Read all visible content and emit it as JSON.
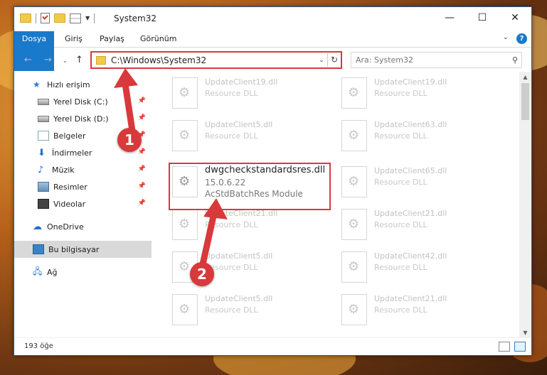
{
  "window": {
    "title": "System32",
    "controls": {
      "minimize": "—",
      "maximize": "☐",
      "close": "✕"
    }
  },
  "ribbon": {
    "tabs": [
      "Dosya",
      "Giriş",
      "Paylaş",
      "Görünüm"
    ],
    "help": "?"
  },
  "address": {
    "path": "C:\\Windows\\System32",
    "search_placeholder": "Ara: System32"
  },
  "sidebar": {
    "items": [
      {
        "label": "Hızlı erişim",
        "icon": "star-icon"
      },
      {
        "label": "Yerel Disk (C:)",
        "icon": "drive-icon",
        "pinned": true
      },
      {
        "label": "Yerel Disk (D:)",
        "icon": "drive-icon",
        "pinned": true
      },
      {
        "label": "Belgeler",
        "icon": "documents-icon",
        "pinned": true
      },
      {
        "label": "İndirmeler",
        "icon": "download-icon",
        "pinned": true
      },
      {
        "label": "Müzik",
        "icon": "music-icon",
        "pinned": true
      },
      {
        "label": "Resimler",
        "icon": "pictures-icon",
        "pinned": true
      },
      {
        "label": "Videolar",
        "icon": "videos-icon",
        "pinned": true
      },
      {
        "label": "OneDrive",
        "icon": "cloud-icon"
      },
      {
        "label": "Bu bilgisayar",
        "icon": "pc-icon",
        "selected": true
      },
      {
        "label": "Ağ",
        "icon": "network-icon"
      }
    ]
  },
  "files": {
    "left_column": [
      {
        "name": "UpdateClient19.dll",
        "type": "Resource DLL"
      },
      {
        "name": "UpdateClient5.dll",
        "type": "Resource DLL"
      },
      {
        "name": "dwgcheckstandardsres.dll",
        "version": "15.0.6.22",
        "description": "AcStdBatchRes Module"
      },
      {
        "name": "UpdateClient21.dll",
        "type": "Resource DLL"
      },
      {
        "name": "UpdateClient5.dll",
        "type": "Resource DLL"
      },
      {
        "name": "UpdateClient5.dll",
        "type": "Resource DLL"
      }
    ],
    "right_column": [
      {
        "name": "UpdateClient19.dll",
        "type": "Resource DLL"
      },
      {
        "name": "UpdateClient63.dll",
        "type": "Resource DLL"
      },
      {
        "name": "UpdateClient65.dll",
        "type": "Resource DLL"
      },
      {
        "name": "UpdateClient21.dll",
        "type": "Resource DLL"
      },
      {
        "name": "UpdateClient42.dll",
        "type": "Resource DLL"
      },
      {
        "name": "UpdateClient21.dll",
        "type": "Resource DLL"
      }
    ]
  },
  "status": {
    "count": "193 öğe"
  },
  "annotations": {
    "step1": "1",
    "step2": "2"
  },
  "colors": {
    "accent": "#1979ca",
    "highlight": "#d8393b"
  }
}
